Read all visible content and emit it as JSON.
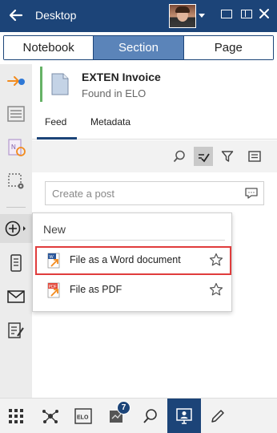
{
  "header": {
    "title": "Desktop"
  },
  "segments": [
    {
      "label": "Notebook"
    },
    {
      "label": "Section",
      "active": true
    },
    {
      "label": "Page"
    }
  ],
  "document": {
    "title": "EXTEN Invoice",
    "subtitle": "Found in ELO",
    "status_color": "#66b266"
  },
  "tabs": [
    {
      "label": "Feed",
      "active": true
    },
    {
      "label": "Metadata"
    }
  ],
  "feed": {
    "post_placeholder": "Create a post"
  },
  "new_menu": {
    "title": "New",
    "items": [
      {
        "label": "File as a Word document",
        "icon": "word-file-icon",
        "highlighted": true
      },
      {
        "label": "File as PDF",
        "icon": "pdf-file-icon"
      }
    ]
  },
  "bottom_bar": {
    "elo_label": "ELO",
    "notification_count": "7"
  },
  "colors": {
    "primary": "#1c4478",
    "segment_active": "#5b84b9",
    "highlight": "#e03c3c",
    "orange": "#f28b1e"
  }
}
